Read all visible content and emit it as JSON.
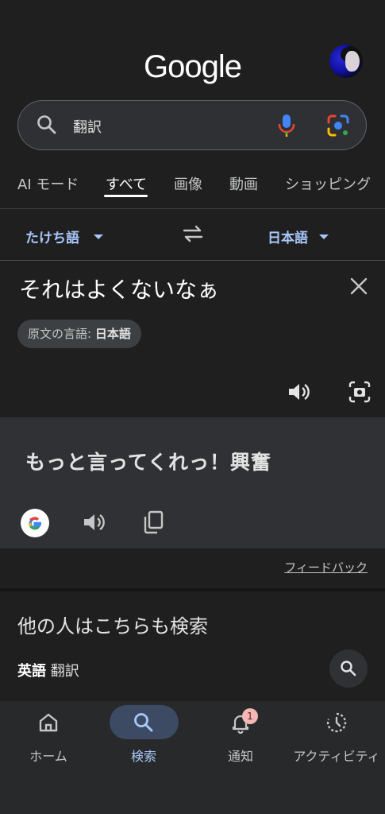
{
  "header": {
    "logo": "Google"
  },
  "search": {
    "query": "翻訳"
  },
  "tabs": [
    {
      "label": "AI モード"
    },
    {
      "label": "すべて",
      "active": true
    },
    {
      "label": "画像"
    },
    {
      "label": "動画"
    },
    {
      "label": "ショッピング"
    }
  ],
  "translator": {
    "source_lang": "たけち語",
    "target_lang": "日本語",
    "source_text": "それはよくないなぁ",
    "detected_prefix": "原文の言語: ",
    "detected_lang": "日本語",
    "result_text": "もっと言ってくれっ！興奮",
    "feedback": "フィードバック"
  },
  "related": {
    "title": "他の人はこちらも検索",
    "items": [
      {
        "bold": "英語",
        "rest": " 翻訳"
      }
    ]
  },
  "bottom_nav": {
    "items": [
      {
        "label": "ホーム",
        "icon": "home-icon"
      },
      {
        "label": "検索",
        "icon": "search-icon",
        "active": true
      },
      {
        "label": "通知",
        "icon": "bell-icon"
      },
      {
        "label": "アクティビティ",
        "icon": "activity-icon"
      }
    ],
    "notification_count": "1"
  },
  "colors": {
    "background": "#1f1f1f",
    "accent": "#a8c7fa",
    "active_pill": "#3c4b63",
    "badge": "#f2b8b5"
  }
}
